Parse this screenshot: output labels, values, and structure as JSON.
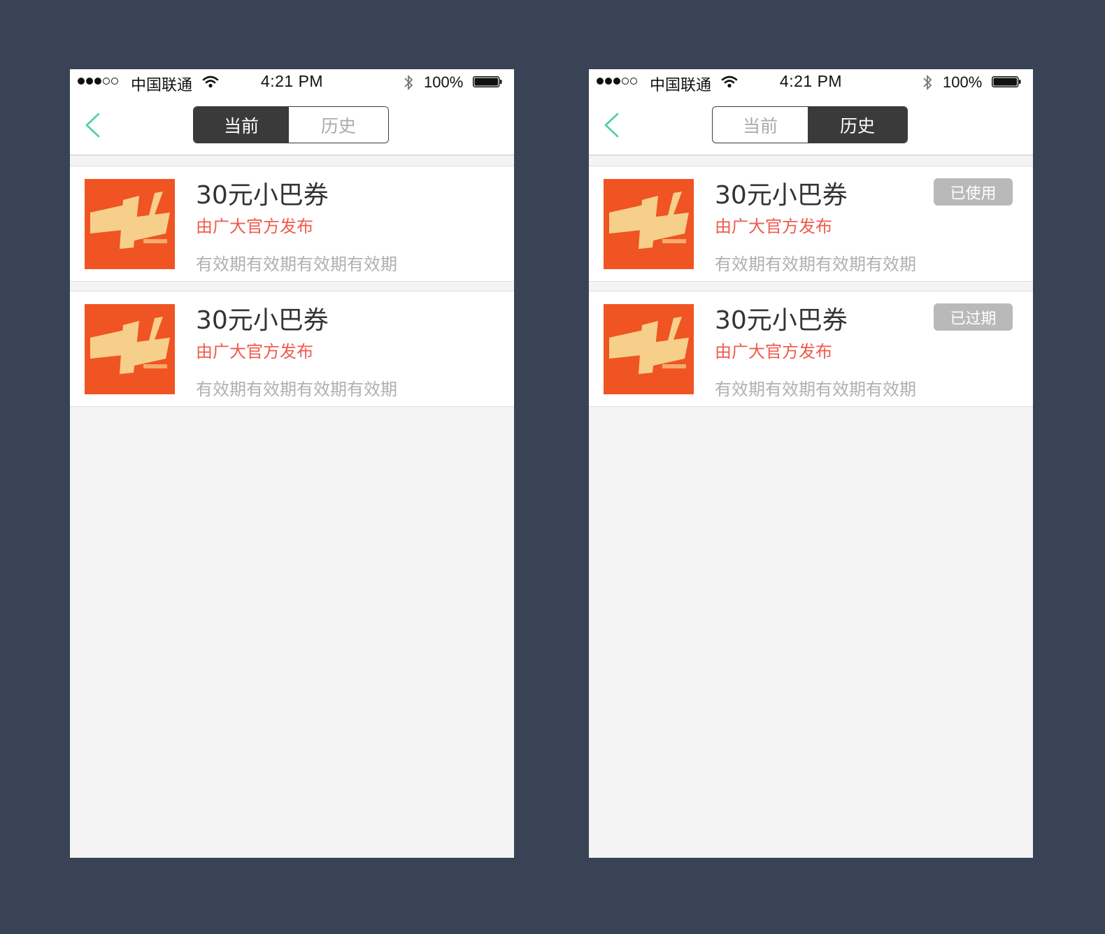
{
  "colors": {
    "background": "#394355",
    "accent_back": "#4ecfa6",
    "publisher_text": "#ef5b4d",
    "segment_active": "#3a3a3a",
    "badge": "#b9b9b9",
    "thumbnail": "#f05423"
  },
  "status_bar": {
    "carrier": "中国联通",
    "time": "4:21 PM",
    "battery": "100%"
  },
  "tabs": {
    "current": "当前",
    "history": "历史"
  },
  "current_screen": {
    "active_tab": "current",
    "coupons": [
      {
        "thumbnail": "抢抢抢 promo image",
        "title": "30元小巴券",
        "publisher": "由广大官方发布",
        "validity": "有效期有效期有效期有效期"
      },
      {
        "thumbnail": "抢抢抢 promo image",
        "title": "30元小巴券",
        "publisher": "由广大官方发布",
        "validity": "有效期有效期有效期有效期"
      }
    ]
  },
  "history_screen": {
    "active_tab": "history",
    "coupons": [
      {
        "thumbnail": "抢抢抢 promo image",
        "title": "30元小巴券",
        "publisher": "由广大官方发布",
        "validity": "有效期有效期有效期有效期",
        "status": "已使用"
      },
      {
        "thumbnail": "抢抢抢 promo image",
        "title": "30元小巴券",
        "publisher": "由广大官方发布",
        "validity": "有效期有效期有效期有效期",
        "status": "已过期"
      }
    ]
  }
}
